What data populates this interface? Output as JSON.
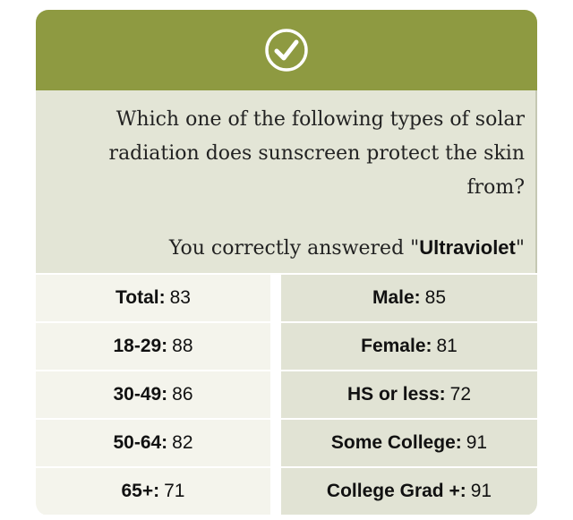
{
  "header": {
    "icon": "check-circle-icon",
    "color": "#8e9a41"
  },
  "question": {
    "text": "Which one of the following types of solar radiation does sunscreen protect the skin from?",
    "answer_prefix": "You correctly answered \"",
    "answer_value": "Ultraviolet",
    "answer_suffix": "\""
  },
  "stats": [
    {
      "left": {
        "label": "Total:",
        "value": "83"
      },
      "right": {
        "label": "Male:",
        "value": "85"
      }
    },
    {
      "left": {
        "label": "18-29:",
        "value": "88"
      },
      "right": {
        "label": "Female:",
        "value": "81"
      }
    },
    {
      "left": {
        "label": "30-49:",
        "value": "86"
      },
      "right": {
        "label": "HS or less:",
        "value": "72"
      }
    },
    {
      "left": {
        "label": "50-64:",
        "value": "82"
      },
      "right": {
        "label": "Some College:",
        "value": "91"
      }
    },
    {
      "left": {
        "label": "65+:",
        "value": "71"
      },
      "right": {
        "label": "College Grad +:",
        "value": "91"
      }
    }
  ]
}
